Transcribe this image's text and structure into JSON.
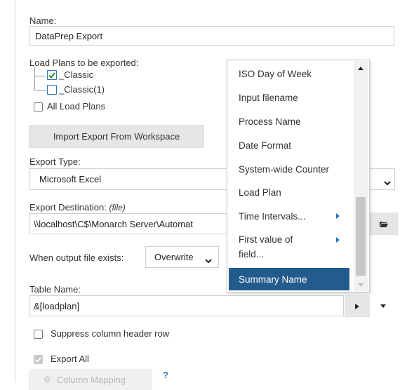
{
  "name": {
    "label": "Name:",
    "value": "DataPrep Export"
  },
  "load_plans": {
    "label": "Load Plans to be exported:",
    "items": [
      {
        "label": "_Classic",
        "checked": true
      },
      {
        "label": "_Classic(1)",
        "checked": false
      }
    ],
    "all_label": "All Load Plans"
  },
  "import_button": "Import Export From Workspace",
  "export_type": {
    "label": "Export Type:",
    "value": "Microsoft Excel"
  },
  "export_destination": {
    "label": "Export Destination:",
    "hint": "(file)",
    "value": "\\\\localhost\\C$\\Monarch Server\\Automat"
  },
  "file_exists": {
    "label": "When output file exists:",
    "value": "Overwrite"
  },
  "table_name": {
    "label": "Table Name:",
    "value": "&[loadplan]"
  },
  "suppress_header": "Suppress column header row",
  "export_all": "Export All",
  "column_mapping": "Column Mapping",
  "help": "?",
  "dropdown": {
    "items": [
      {
        "label": "ISO Day of Week"
      },
      {
        "label": "Input filename"
      },
      {
        "label": "Process Name"
      },
      {
        "label": "Date Format"
      },
      {
        "label": "System-wide Counter"
      },
      {
        "label": "Load Plan"
      },
      {
        "label": "Time Intervals...",
        "submenu": true
      },
      {
        "label": "First value of",
        "label2": "field...",
        "submenu": true
      },
      {
        "label": "Summary Name",
        "selected": true
      }
    ]
  },
  "colors": {
    "selected_bg": "#245b8d",
    "accent": "#2e74b5",
    "button_bg": "#e6e6e6"
  },
  "icons": [
    "checkmark-icon",
    "chevron-down-icon",
    "folder-open-icon",
    "play-icon",
    "gear-icon",
    "scroll-up-icon",
    "scroll-down-icon"
  ]
}
